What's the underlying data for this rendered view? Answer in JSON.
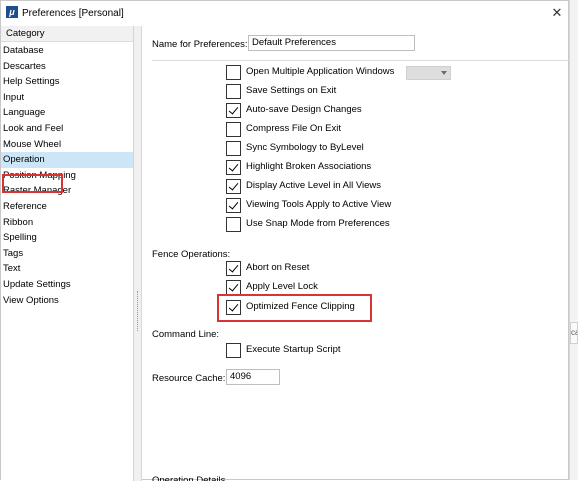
{
  "window": {
    "title": "Preferences [Personal]",
    "app_icon_glyph": "μ",
    "close_glyph": "✕"
  },
  "category": {
    "header": "Category",
    "items": [
      {
        "label": "Database"
      },
      {
        "label": "Descartes"
      },
      {
        "label": "Help Settings"
      },
      {
        "label": "Input"
      },
      {
        "label": "Language"
      },
      {
        "label": "Look and Feel"
      },
      {
        "label": "Mouse Wheel"
      },
      {
        "label": "Operation",
        "selected": true
      },
      {
        "label": "Position Mapping"
      },
      {
        "label": "Raster Manager"
      },
      {
        "label": "Reference"
      },
      {
        "label": "Ribbon"
      },
      {
        "label": "Spelling"
      },
      {
        "label": "Tags"
      },
      {
        "label": "Text"
      },
      {
        "label": "Update Settings"
      },
      {
        "label": "View Options"
      }
    ]
  },
  "main": {
    "name_label": "Name for Preferences:",
    "name_value": "Default Preferences",
    "options": [
      {
        "label": "Open Multiple Application Windows",
        "checked": false
      },
      {
        "label": "Save Settings on Exit",
        "checked": false
      },
      {
        "label": "Auto-save Design Changes",
        "checked": true
      },
      {
        "label": "Compress File On Exit",
        "checked": false
      },
      {
        "label": "Sync Symbology to ByLevel",
        "checked": false
      },
      {
        "label": "Highlight Broken Associations",
        "checked": true
      },
      {
        "label": "Display Active Level in All Views",
        "checked": true
      },
      {
        "label": "Viewing Tools Apply to Active View",
        "checked": true
      },
      {
        "label": "Use Snap Mode from Preferences",
        "checked": false
      }
    ],
    "fence_label": "Fence Operations:",
    "fence_options": [
      {
        "label": "Abort on Reset",
        "checked": true
      },
      {
        "label": "Apply Level Lock",
        "checked": true
      },
      {
        "label": "Optimized Fence Clipping",
        "checked": true
      }
    ],
    "command_label": "Command Line:",
    "command_options": [
      {
        "label": "Execute Startup Script",
        "checked": false
      }
    ],
    "cache_label": "Resource Cache:",
    "cache_value": "4096",
    "cut_off_label": "Operation Details"
  },
  "edge": {
    "partial_text": "ca"
  }
}
